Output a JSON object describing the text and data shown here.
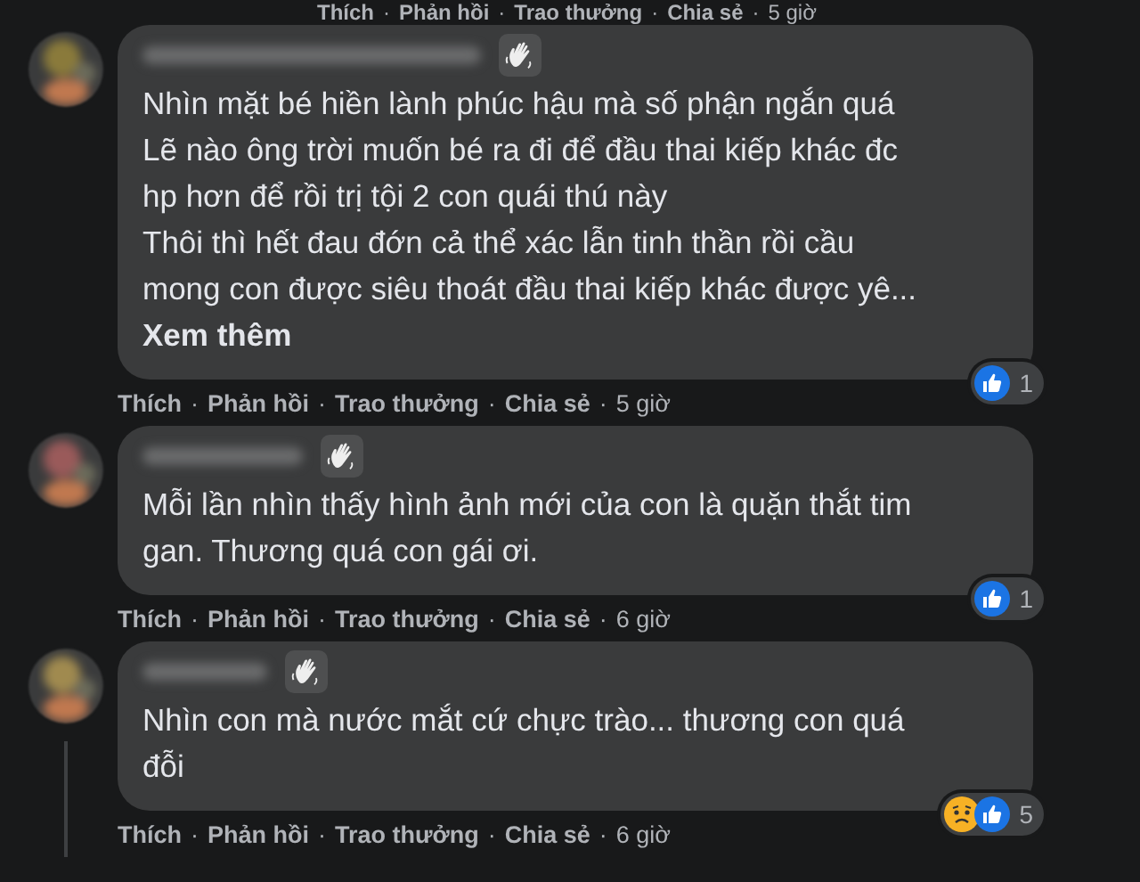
{
  "top_actions": {
    "actions": [
      "Thích",
      "Phản hồi",
      "Trao thưởng",
      "Chia sẻ"
    ],
    "separator": "·",
    "time": "5 giờ"
  },
  "comments": [
    {
      "lines": [
        "Nhìn mặt bé hiền lành phúc hậu mà số phận ngắn quá",
        "Lẽ nào ông trời muốn bé ra đi để đầu thai kiếp khác đc",
        "hp hơn để rồi trị tội 2 con quái thú này",
        "Thôi thì hết đau đớn cả thể xác lẫn tinh thần rồi cầu",
        "mong con được siêu thoát đầu thai kiếp khác được yê..."
      ],
      "see_more": "Xem thêm",
      "reactions": [
        {
          "kind": "like"
        }
      ],
      "reaction_count": "1",
      "actions": [
        "Thích",
        "Phản hồi",
        "Trao thưởng",
        "Chia sẻ"
      ],
      "separator": "·",
      "time": "5 giờ",
      "thread": false
    },
    {
      "lines": [
        "Mỗi lần nhìn thấy hình ảnh mới của con là quặn thắt tim",
        "gan. Thương quá con gái ơi."
      ],
      "reactions": [
        {
          "kind": "like"
        }
      ],
      "reaction_count": "1",
      "actions": [
        "Thích",
        "Phản hồi",
        "Trao thưởng",
        "Chia sẻ"
      ],
      "separator": "·",
      "time": "6 giờ",
      "thread": false
    },
    {
      "lines": [
        "Nhìn con mà nước mắt cứ chực trào... thương con quá",
        "đỗi"
      ],
      "reactions": [
        {
          "kind": "sad"
        },
        {
          "kind": "like"
        }
      ],
      "reaction_count": "5",
      "actions": [
        "Thích",
        "Phản hồi",
        "Trao thưởng",
        "Chia sẻ"
      ],
      "separator": "·",
      "time": "6 giờ",
      "thread": true
    }
  ]
}
